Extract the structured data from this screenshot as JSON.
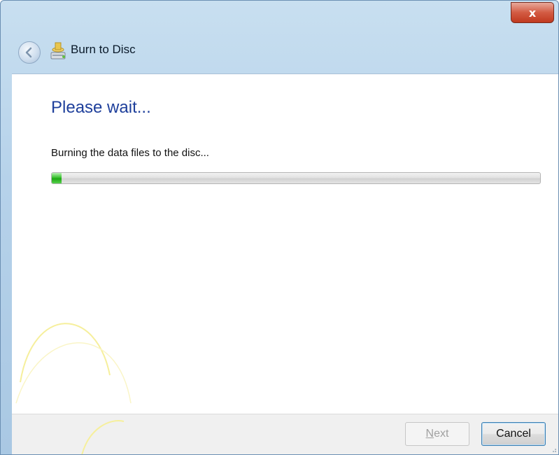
{
  "window": {
    "title": "Burn to Disc",
    "close_glyph": "x"
  },
  "icons": {
    "back": "back-arrow-icon",
    "app": "burn-disc-icon",
    "close": "close-icon"
  },
  "content": {
    "heading": "Please wait...",
    "status": "Burning the data files to the disc...",
    "progress_percent": 2
  },
  "footer": {
    "next_label_mnemonic": "N",
    "next_label_rest": "ext",
    "next_enabled": false,
    "cancel_label": "Cancel"
  },
  "colors": {
    "heading": "#1e3f9b",
    "progress_fill": "#1ea814",
    "title_bar": "#b6d2ea",
    "close_button": "#c0391f"
  }
}
